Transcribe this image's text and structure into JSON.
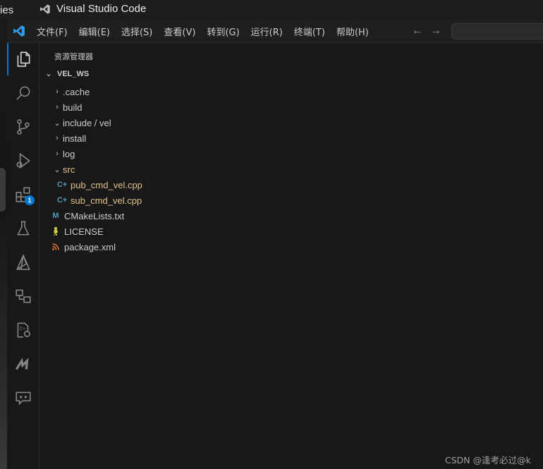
{
  "topbar": {
    "left_fragment": "ies",
    "app_name": "Visual Studio Code"
  },
  "menu": [
    "文件(F)",
    "编辑(E)",
    "选择(S)",
    "查看(V)",
    "转到(G)",
    "运行(R)",
    "终端(T)",
    "帮助(H)"
  ],
  "nav": {
    "back": "←",
    "forward": "→"
  },
  "activity_bar": {
    "items": [
      "explorer-icon",
      "search-icon",
      "source-control-icon",
      "run-debug-icon",
      "extensions-icon",
      "testing-icon",
      "remote-explorer-icon",
      "flow-icon",
      "cmake-icon",
      "marp-icon",
      "chat-icon"
    ],
    "extensions_badge": "1"
  },
  "explorer": {
    "title": "资源管理器",
    "workspace": "VEL_WS",
    "tree": [
      {
        "label": ".cache",
        "chevron": "›",
        "icon": "",
        "modified": false
      },
      {
        "label": "build",
        "chevron": "›",
        "icon": "",
        "modified": false
      },
      {
        "label": "include / vel",
        "chevron": "⌄",
        "icon": "",
        "modified": false
      },
      {
        "label": "install",
        "chevron": "›",
        "icon": "",
        "modified": false
      },
      {
        "label": "log",
        "chevron": "›",
        "icon": "",
        "modified": false
      },
      {
        "label": "src",
        "chevron": "⌄",
        "icon": "",
        "modified": true
      },
      {
        "label": "pub_cmd_vel.cpp",
        "chevron": "",
        "icon": "C+",
        "modified": true
      },
      {
        "label": "sub_cmd_vel.cpp",
        "chevron": "",
        "icon": "C+",
        "modified": true
      },
      {
        "label": "CMakeLists.txt",
        "chevron": "",
        "icon": "M",
        "modified": false
      },
      {
        "label": "LICENSE",
        "chevron": "",
        "icon": "license-icon",
        "modified": false
      },
      {
        "label": "package.xml",
        "chevron": "",
        "icon": "rss-icon",
        "modified": false
      }
    ]
  },
  "watermark": "CSDN @逢考必过@k",
  "colors": {
    "accent": "#0078d4",
    "modified": "#e2c08d",
    "cpp": "#519aba",
    "cmake": "#519aba",
    "xml": "#e37933",
    "license": "#cbcb41"
  }
}
